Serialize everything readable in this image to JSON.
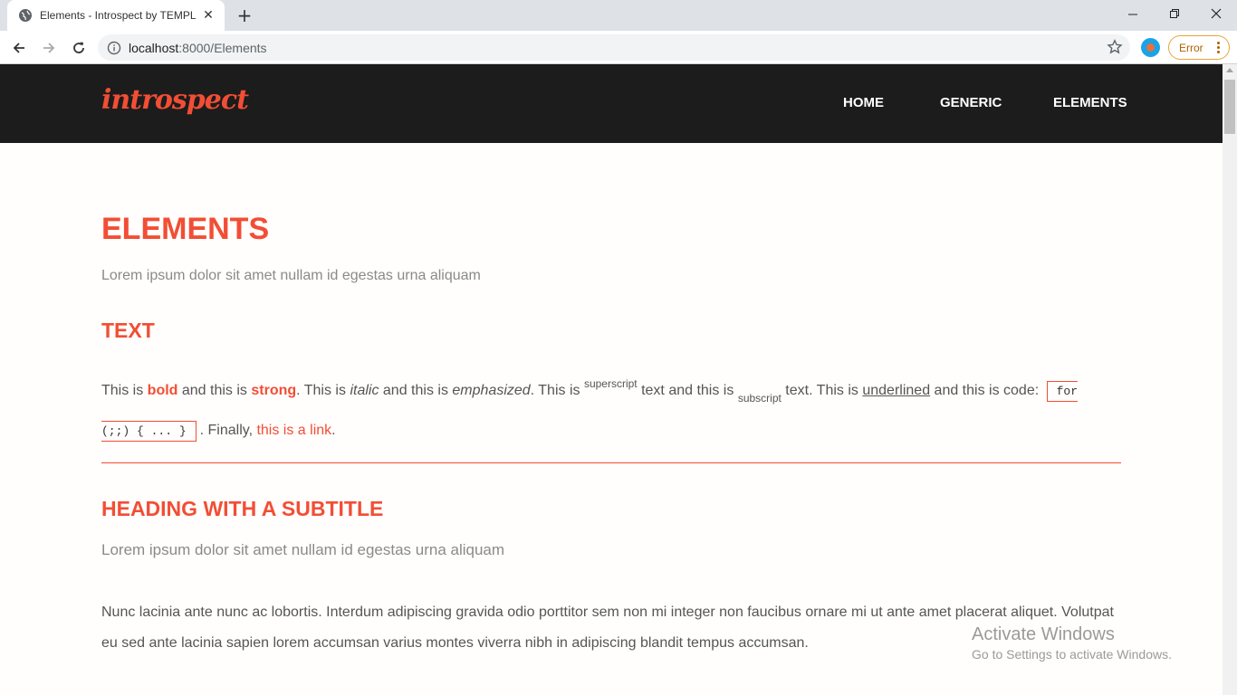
{
  "browser": {
    "tab_title": "Elements - Introspect by TEMPLA",
    "url_host": "localhost",
    "url_path": ":8000/Elements",
    "error_label": "Error"
  },
  "site": {
    "logo": "introspect",
    "nav": [
      "HOME",
      "GENERIC",
      "ELEMENTS"
    ],
    "accent_color": "#f24e35",
    "header_bg": "#1c1c1c"
  },
  "page": {
    "title": "ELEMENTS",
    "subtitle": "Lorem ipsum dolor sit amet nullam id egestas urna aliquam",
    "text_heading": "TEXT",
    "text": {
      "p1": "This is ",
      "bold": "bold",
      "p2": " and this is ",
      "strong": "strong",
      "p3": ". This is ",
      "italic": "italic",
      "p4": " and this is ",
      "emphasized": "emphasized",
      "p5": ". This is ",
      "superscript": "superscript",
      "p6": " text and this is ",
      "subscript": "subscript",
      "p7": " text. This is ",
      "underlined": "underlined",
      "p8": " and this is code: ",
      "code": "for (;;) { ... }",
      "p9": ". Finally, ",
      "link": "this is a link",
      "p10": "."
    },
    "heading2": "HEADING WITH A SUBTITLE",
    "heading2_subtitle": "Lorem ipsum dolor sit amet nullam id egestas urna aliquam",
    "paragraph": "Nunc lacinia ante nunc ac lobortis. Interdum adipiscing gravida odio porttitor sem non mi integer non faucibus ornare mi ut ante amet placerat aliquet. Volutpat eu sed ante lacinia sapien lorem accumsan varius montes viverra nibh in adipiscing blandit tempus accumsan."
  },
  "watermark": {
    "line1": "Activate Windows",
    "line2": "Go to Settings to activate Windows."
  }
}
